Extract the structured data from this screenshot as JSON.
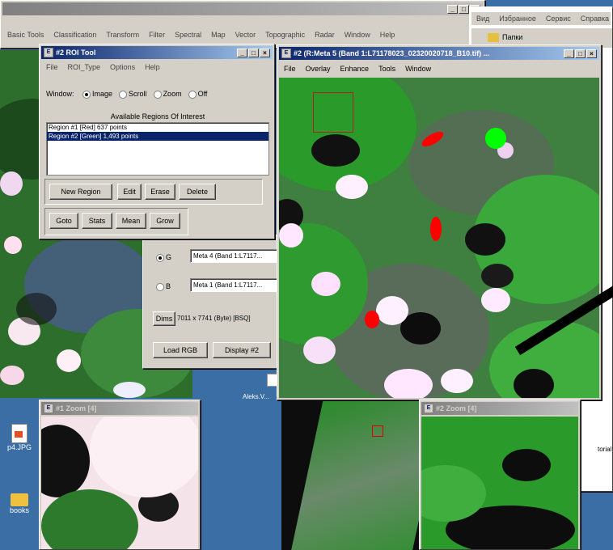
{
  "envi_main": {
    "menu": [
      "Basic Tools",
      "Classification",
      "Transform",
      "Filter",
      "Spectral",
      "Map",
      "Vector",
      "Topographic",
      "Radar",
      "Window",
      "Help"
    ]
  },
  "bg_explorer": {
    "menu": [
      "Вид",
      "Избранное",
      "Сервис",
      "Справка"
    ],
    "folder_label": "Папки"
  },
  "roi_tool": {
    "title": "#2 ROI Tool",
    "menu": [
      "File",
      "ROI_Type",
      "Options",
      "Help"
    ],
    "window_label": "Window:",
    "radio": [
      "Image",
      "Scroll",
      "Zoom",
      "Off"
    ],
    "regions_heading": "Available Regions Of Interest",
    "regions": [
      "Region #1 [Red] 637 points",
      "Region #2 [Green] 1,493 points"
    ],
    "buttons_row1": [
      "New Region",
      "Edit",
      "Erase",
      "Delete"
    ],
    "buttons_row2": [
      "Goto",
      "Stats",
      "Mean",
      "Grow"
    ]
  },
  "band_list": {
    "g_label": "G",
    "g_value": "Meta 4 (Band 1:L7117...",
    "b_label": "B",
    "b_value": "Meta 1 (Band 1:L7117...",
    "dims_button": "Dims",
    "dims_value": "7011 x 7741 (Byte) [BSQ]",
    "load_rgb": "Load RGB",
    "display": "Display #2"
  },
  "image_window": {
    "title": "#2 (R:Meta 5 (Band 1:L71178023_02320020718_B10.tif) ...",
    "menu": [
      "File",
      "Overlay",
      "Enhance",
      "Tools",
      "Window"
    ]
  },
  "zoom1": {
    "title": "#1 Zoom [4]"
  },
  "zoom2": {
    "title": "#2 Zoom [4]"
  },
  "desktop": {
    "icons": [
      "p4.JPG",
      "books"
    ],
    "label_aleks": "Aleks.V...",
    "label_tutorial": "torial.tgt"
  },
  "colors": {
    "veg_green": "#2e9e2e",
    "roi_red": "#ff0000",
    "roi_green": "#00ff00",
    "win_face": "#d4d0c8",
    "title_active": "#0a246a"
  }
}
